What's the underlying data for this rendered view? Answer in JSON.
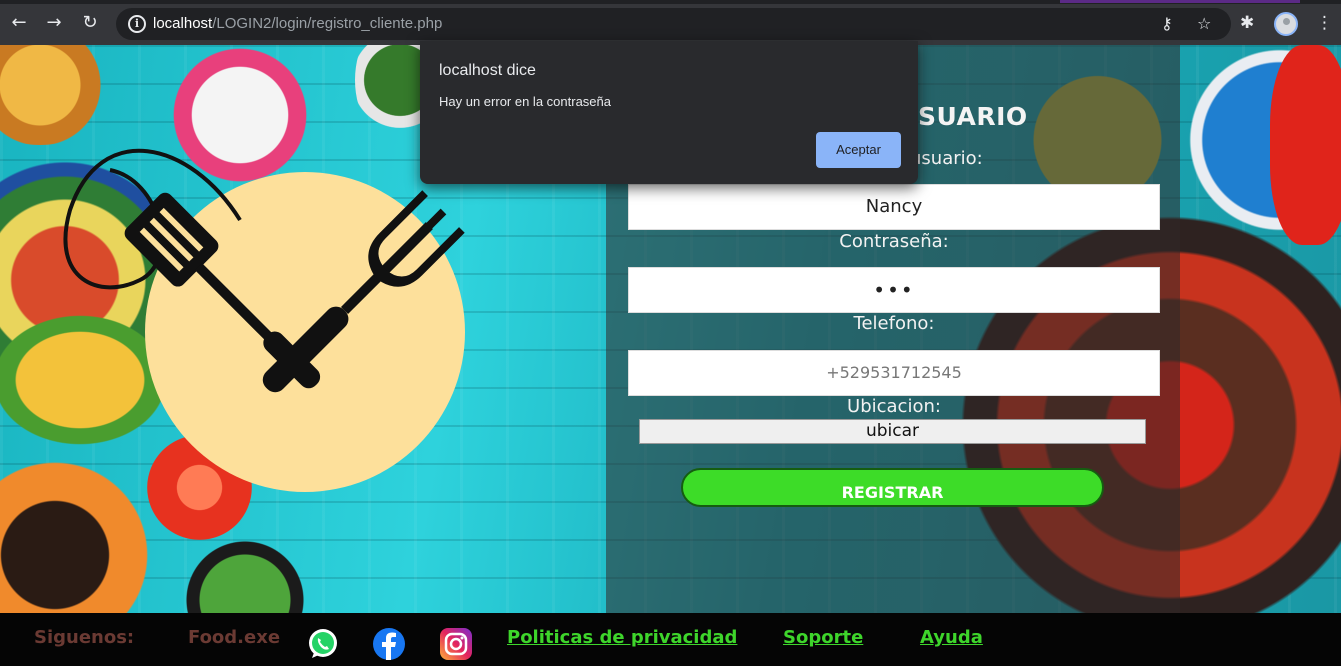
{
  "browser": {
    "url_host": "localhost",
    "url_path": "/LOGIN2/login/registro_cliente.php"
  },
  "form": {
    "title_visible": "SUARIO",
    "user_label_visible": "usuario:",
    "user_value": "Nancy",
    "password_label": "Contraseña:",
    "password_value": "•••",
    "phone_label": "Telefono:",
    "phone_placeholder": "+529531712545",
    "location_label": "Ubicacion:",
    "locate_button": "ubicar",
    "register_button": "REGISTRAR"
  },
  "dialog": {
    "title": "localhost dice",
    "message": "Hay un error en la contraseña",
    "ok_button": "Aceptar"
  },
  "footer": {
    "follow": "Siguenos:",
    "brand": "Food.exe",
    "social_icons": [
      "whatsapp-icon",
      "facebook-icon",
      "instagram-icon"
    ],
    "links": [
      "Politicas de privacidad",
      "Soporte",
      "Ayuda"
    ]
  },
  "colors": {
    "accent_green": "#3ddc28",
    "dialog_button": "#8ab4f8",
    "logo_circle": "#fde09b",
    "footer_bg": "#050505"
  }
}
